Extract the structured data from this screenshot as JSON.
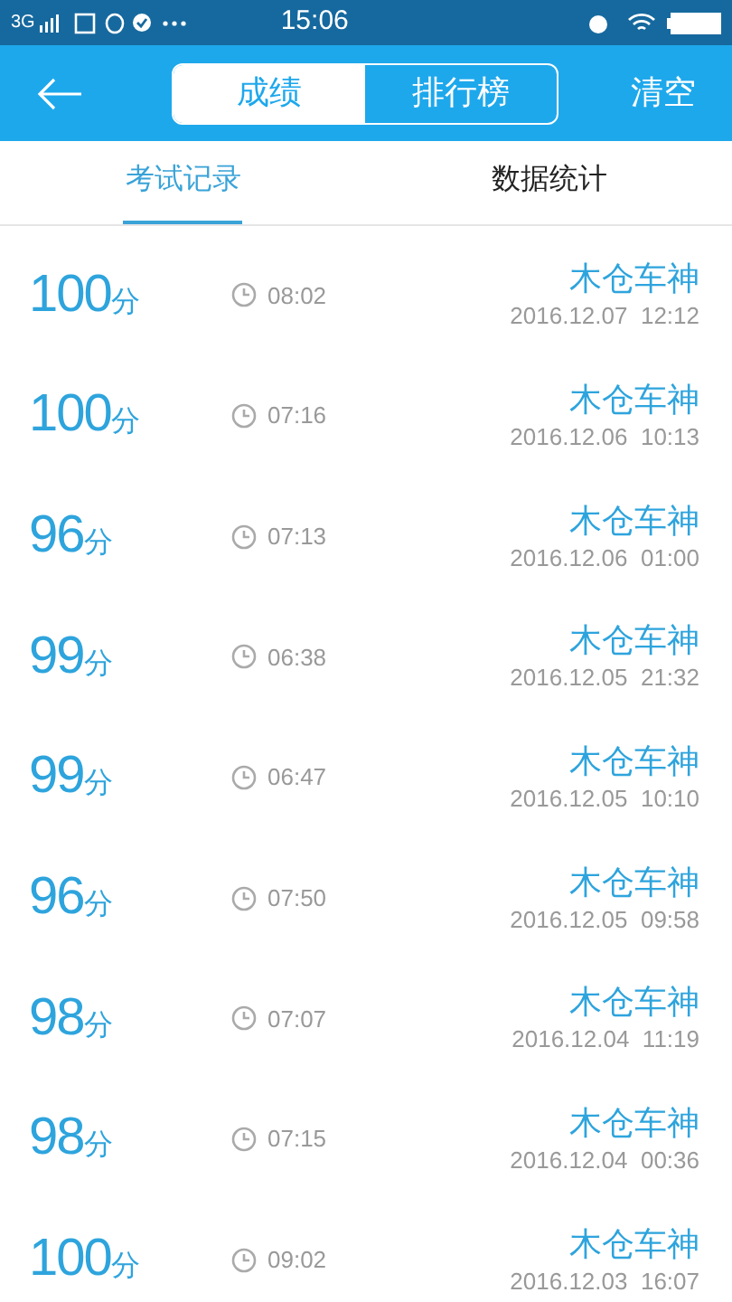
{
  "status_bar": {
    "network": "3G",
    "time": "15:06"
  },
  "header": {
    "segments": [
      {
        "label": "成绩",
        "selected": true
      },
      {
        "label": "排行榜",
        "selected": false
      }
    ],
    "action": "清空"
  },
  "tabs": [
    {
      "label": "考试记录",
      "selected": true
    },
    {
      "label": "数据统计",
      "selected": false
    }
  ],
  "records": [
    {
      "score": "100",
      "unit": "分",
      "duration": "08:02",
      "name": "木仓车神",
      "date": "2016.12.07  12:12"
    },
    {
      "score": "100",
      "unit": "分",
      "duration": "07:16",
      "name": "木仓车神",
      "date": "2016.12.06  10:13"
    },
    {
      "score": "96",
      "unit": "分",
      "duration": "07:13",
      "name": "木仓车神",
      "date": "2016.12.06  01:00"
    },
    {
      "score": "99",
      "unit": "分",
      "duration": "06:38",
      "name": "木仓车神",
      "date": "2016.12.05  21:32"
    },
    {
      "score": "99",
      "unit": "分",
      "duration": "06:47",
      "name": "木仓车神",
      "date": "2016.12.05  10:10"
    },
    {
      "score": "96",
      "unit": "分",
      "duration": "07:50",
      "name": "木仓车神",
      "date": "2016.12.05  09:58"
    },
    {
      "score": "98",
      "unit": "分",
      "duration": "07:07",
      "name": "木仓车神",
      "date": "2016.12.04  11:19"
    },
    {
      "score": "98",
      "unit": "分",
      "duration": "07:15",
      "name": "木仓车神",
      "date": "2016.12.04  00:36"
    },
    {
      "score": "100",
      "unit": "分",
      "duration": "09:02",
      "name": "木仓车神",
      "date": "2016.12.03  16:07"
    }
  ]
}
